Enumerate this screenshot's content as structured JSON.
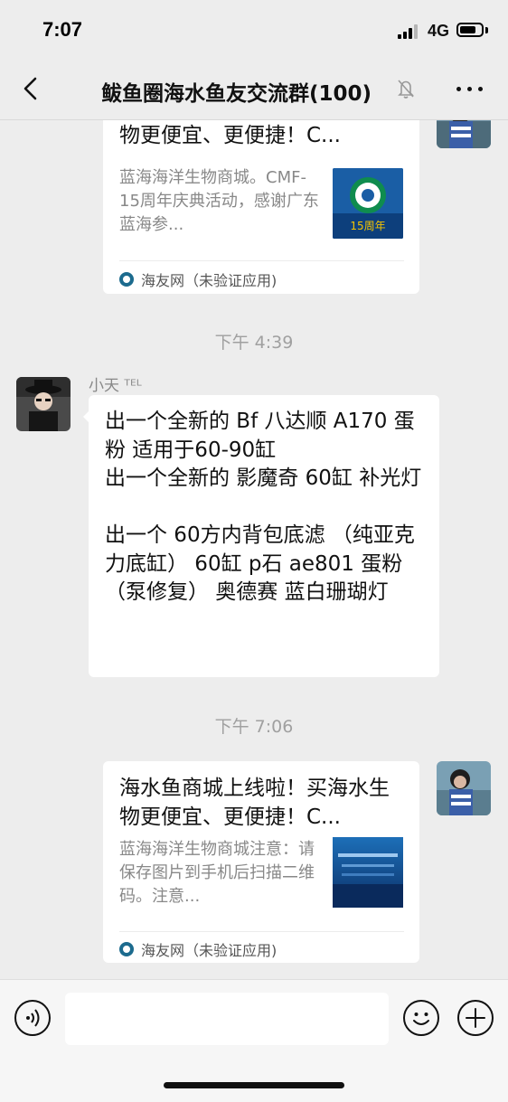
{
  "status_bar": {
    "time": "7:07",
    "network": "4G"
  },
  "nav": {
    "title": "鲅鱼圈海水鱼友交流群(100)"
  },
  "messages": {
    "card_top": {
      "title": "海水鱼商城上线啦！买海水生物更便宜、更便捷！C...",
      "description": "蓝海海洋生物商城。CMF-15周年庆典活动，感谢广东蓝海参...",
      "thumb_text": "15周年",
      "source": "海友网（未验证应用)"
    },
    "timestamp_1": "下午 4:39",
    "text_message": {
      "sender": "小天 ᵀᴱᴸ",
      "body": "出一个全新的 Bf 八达顺 A170 蛋粉 适用于60-90缸\n出一个全新的 影魔奇 60缸 补光灯\n\n出一个 60方内背包底滤 （纯亚克力底缸） 60缸 p石 ae801 蛋粉（泵修复） 奥德赛 蓝白珊瑚灯"
    },
    "timestamp_2": "下午 7:06",
    "card_bottom": {
      "title": "海水鱼商城上线啦！买海水生物更便宜、更便捷！C...",
      "description": "蓝海海洋生物商城注意：请保存图片到手机后扫描二维码。注意...",
      "source": "海友网（未验证应用)"
    }
  },
  "input_bar": {
    "value": ""
  },
  "icons": {
    "back": "chevron-left-icon",
    "mute": "bell-slash-icon",
    "more": "ellipsis-icon",
    "voice": "voice-icon",
    "emoji": "smiley-icon",
    "plus": "plus-icon"
  },
  "colors": {
    "background": "#ededed",
    "bubble": "#ffffff",
    "secondary_text": "#888888"
  }
}
